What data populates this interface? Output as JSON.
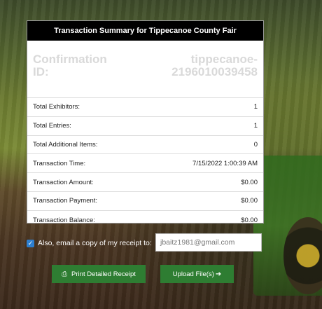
{
  "panel": {
    "title": "Transaction Summary for Tippecanoe County Fair",
    "confirmation_label": "Confirmation ID:",
    "confirmation_value": "tippecanoe-2196010039458",
    "rows": [
      {
        "label": "Total Exhibitors:",
        "value": "1"
      },
      {
        "label": "Total Entries:",
        "value": "1"
      },
      {
        "label": "Total Additional Items:",
        "value": "0"
      },
      {
        "label": "Transaction Time:",
        "value": "7/15/2022 1:00:39 AM"
      },
      {
        "label": "Transaction Amount:",
        "value": "$0.00"
      },
      {
        "label": "Transaction Payment:",
        "value": "$0.00"
      },
      {
        "label": "Transaction Balance:",
        "value": "$0.00"
      }
    ]
  },
  "email": {
    "checkbox_label": "Also, email a copy of my receipt to:",
    "address": "jbaitz1981@gmail.com",
    "checked": true
  },
  "buttons": {
    "print_label": "Print Detailed Receipt",
    "upload_label": "Upload File(s)"
  },
  "colors": {
    "button_green": "#2e7d32",
    "header_black": "#000000",
    "checkbox_blue": "#2d7fd0"
  }
}
